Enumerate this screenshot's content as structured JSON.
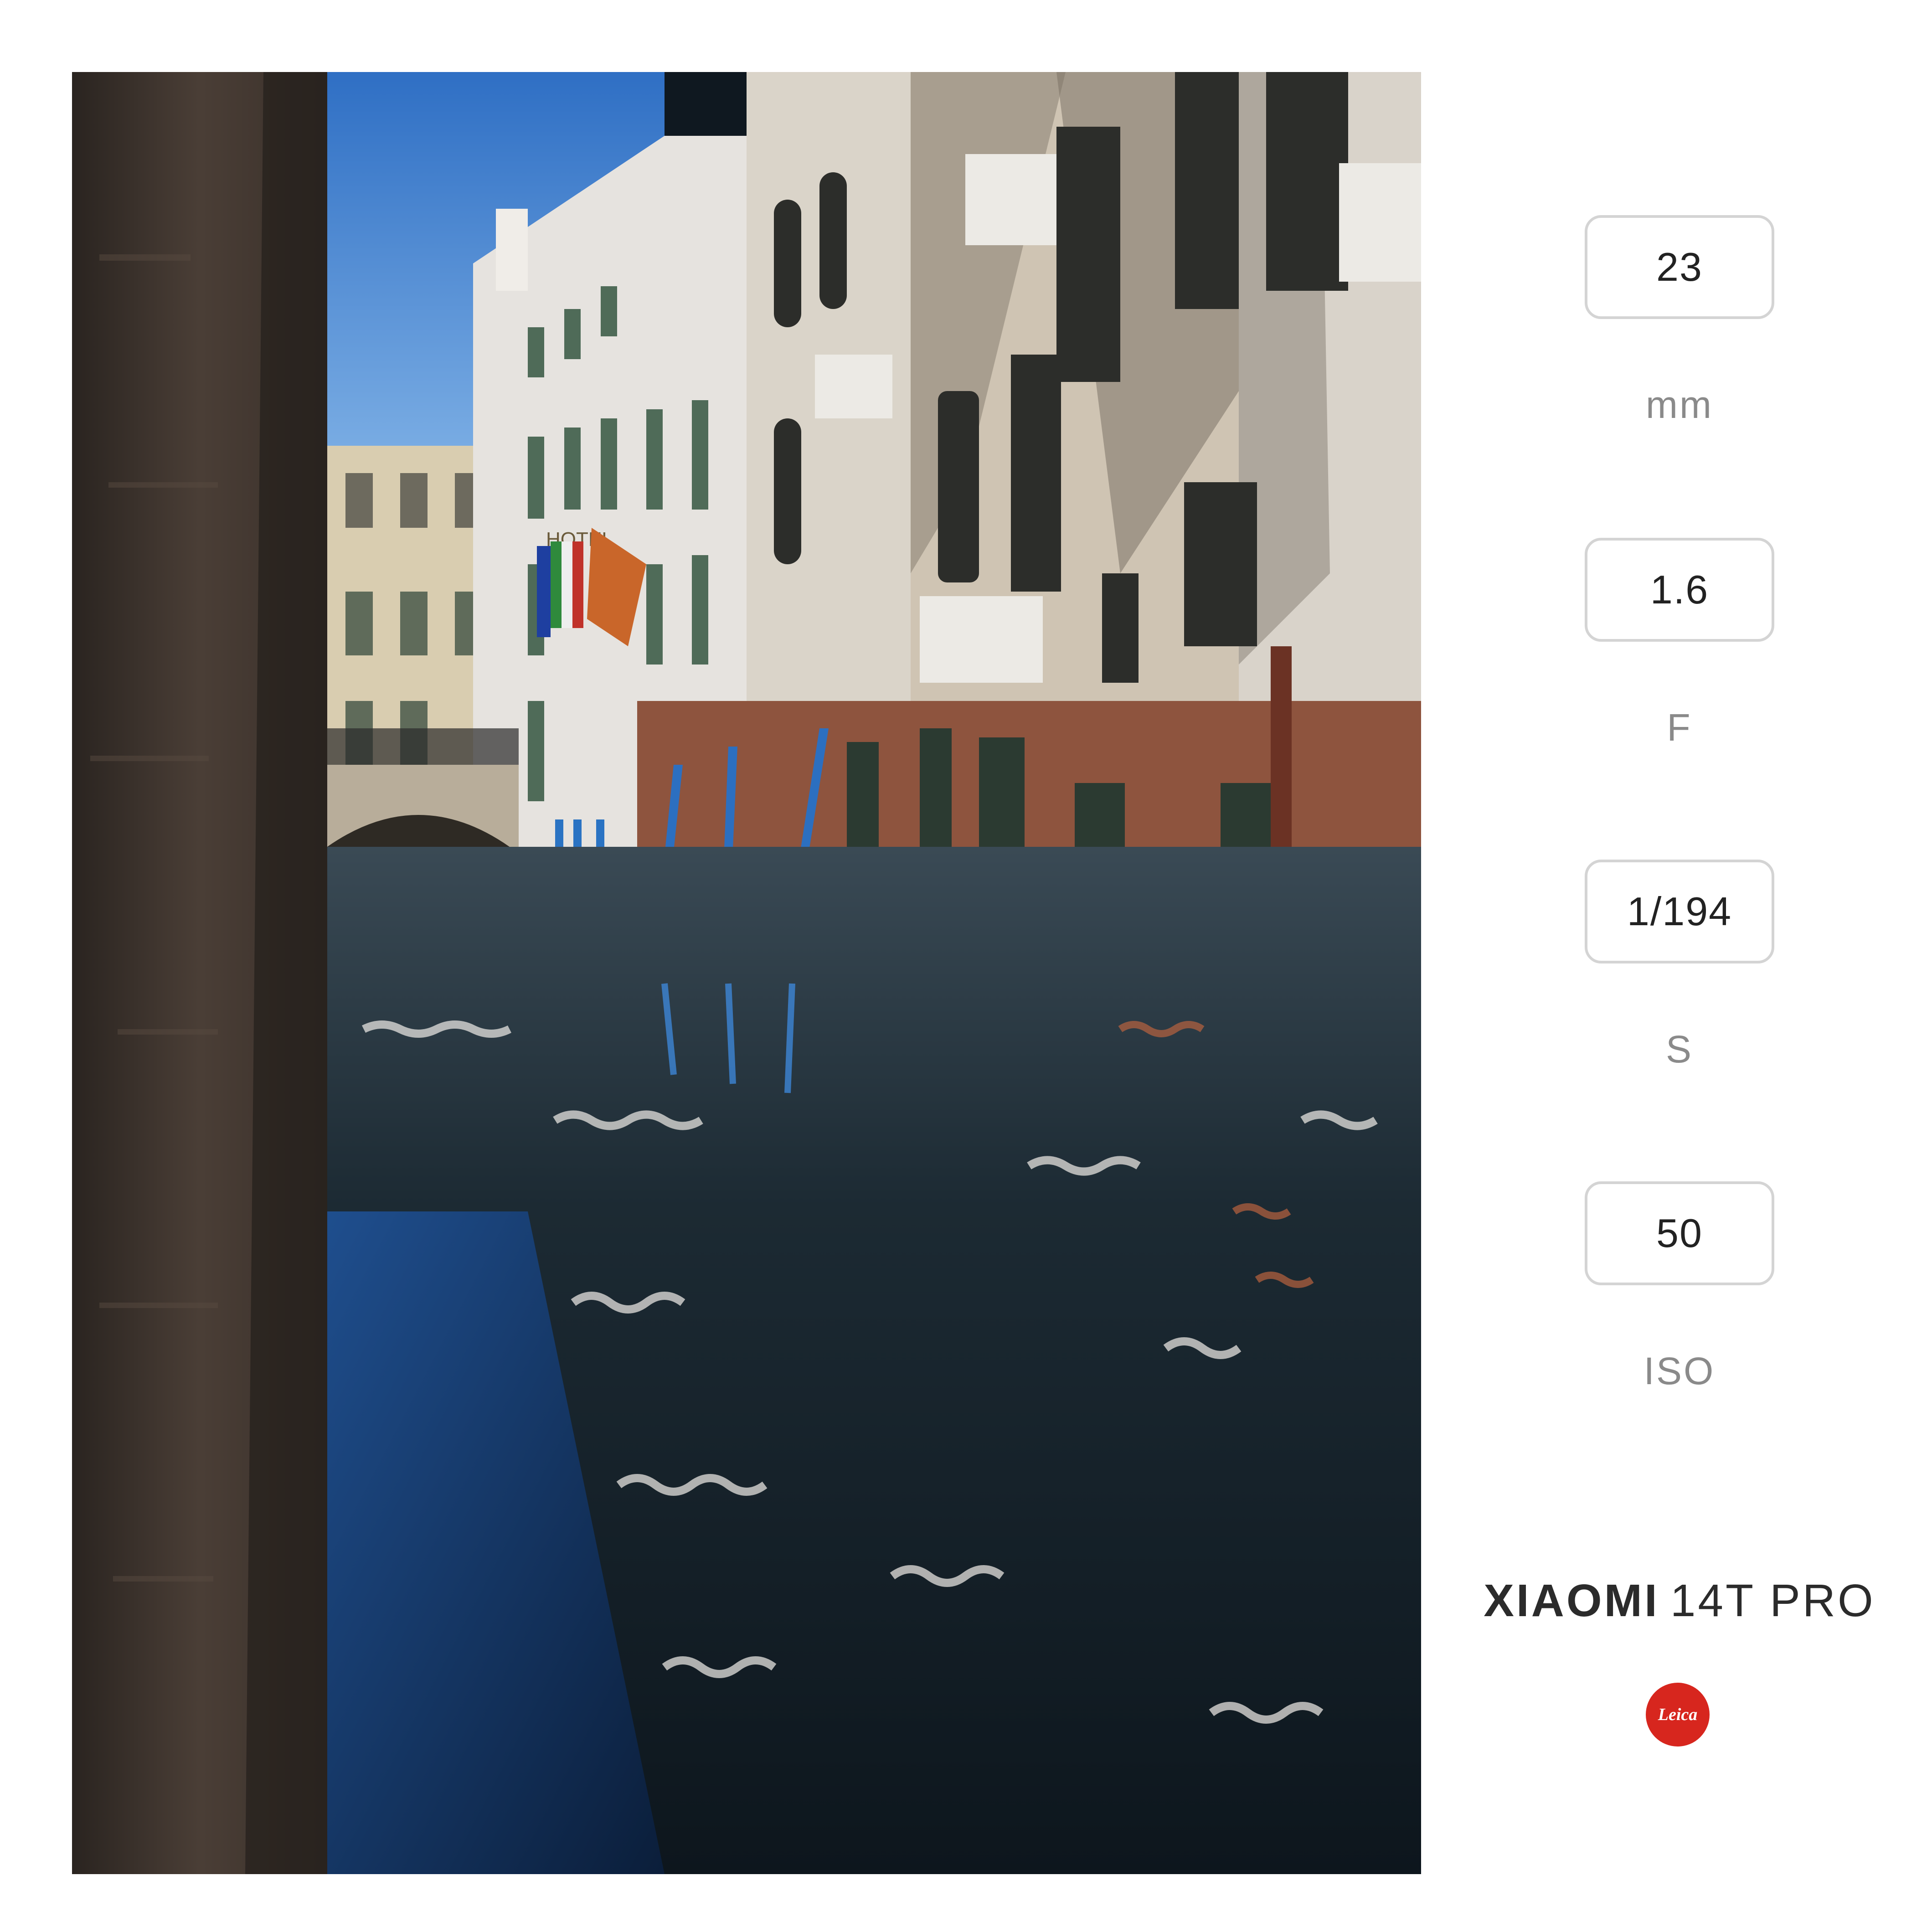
{
  "photo": {
    "description_icon": "photo-canal-venice",
    "sign_text": "HOTEL"
  },
  "exif": {
    "focal_length": {
      "value": "23",
      "unit": "mm"
    },
    "aperture": {
      "value": "1.6",
      "unit": "F"
    },
    "shutter": {
      "value": "1/194",
      "unit": "S"
    },
    "iso": {
      "value": "50",
      "unit": "ISO"
    }
  },
  "camera": {
    "make": "XIAOMI",
    "model": "14T PRO"
  },
  "logo": {
    "text": "Leica",
    "color": "#d7261e"
  }
}
